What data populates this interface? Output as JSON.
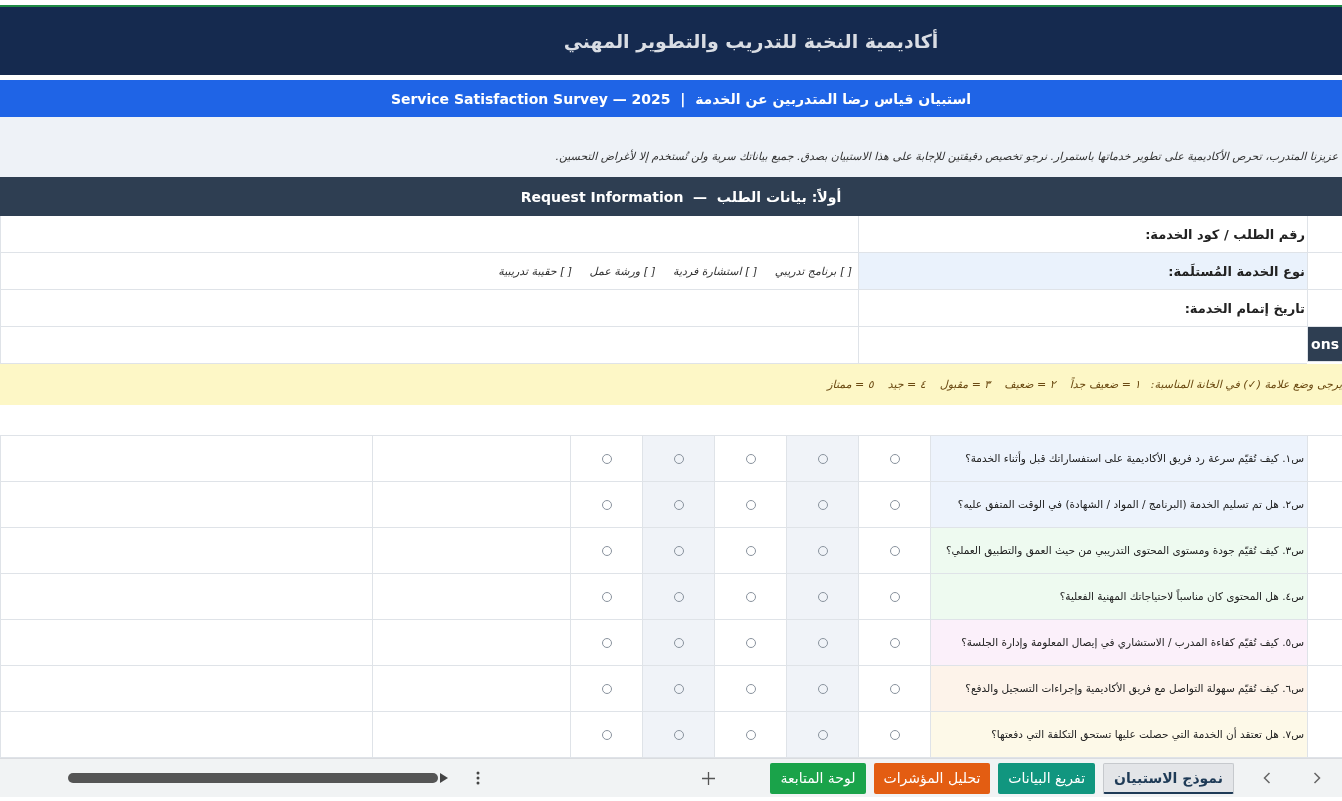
{
  "header": {
    "title": "أكاديمية النخبة للتدريب والتطوير المهني"
  },
  "banner": {
    "title": "استبيان قياس رضا المتدربين عن الخدمة  |  Service Satisfaction Survey — 2025"
  },
  "intro": "عزيزنا المتدرب،  تحرص الأكاديمية على تطوير خدماتها باستمرار. نرجو تخصيص دقيقتين للإجابة على هذا الاستبيان بصدق. جميع بياناتك سرية ولن تُستخدم إلا لأغراض التحسين.",
  "section": {
    "title": "أولاً: بيانات الطلب  —  Request Information"
  },
  "request_fields": [
    {
      "kind": "text",
      "label": "رقم الطلب / كود الخدمة:"
    },
    {
      "kind": "choice",
      "label": "نوع الخدمة المُستلَمة:",
      "value": "[ ] برنامج تدريبي     [ ] استشارة فردية     [ ] ورشة عمل     [ ] حقيبة تدريبية"
    },
    {
      "kind": "text",
      "label": "تاريخ إتمام الخدمة:"
    }
  ],
  "next_section_cell": "ons",
  "rating_hint": "يرجى وضع علامة (✓) في الخانة المناسبة:   ١ = ضعيف جداً    ٢ = ضعيف    ٣ = مقبول    ٤ = جيد    ٥ = ممتاز",
  "questions": [
    {
      "text": "س١. كيف تُقيّم سرعة رد فريق الأكاديمية على استفساراتك قبل وأثناء الخدمة؟",
      "color": "#edf3fc",
      "ratings": [
        {
          "selected": false
        },
        {
          "selected": false
        },
        {
          "selected": false
        },
        {
          "selected": false
        },
        {
          "selected": false
        }
      ]
    },
    {
      "text": "س٢. هل تم تسليم الخدمة (البرنامج / المواد / الشهادة) في الوقت المتفق عليه؟",
      "color": "#edf3fc",
      "ratings": [
        {
          "selected": false
        },
        {
          "selected": false
        },
        {
          "selected": false
        },
        {
          "selected": false
        },
        {
          "selected": false
        }
      ]
    },
    {
      "text": "س٣. كيف تُقيّم جودة ومستوى المحتوى التدريبي من حيث العمق والتطبيق العملي؟",
      "color": "#eefaf0",
      "ratings": [
        {
          "selected": false
        },
        {
          "selected": false
        },
        {
          "selected": false
        },
        {
          "selected": false
        },
        {
          "selected": false
        }
      ]
    },
    {
      "text": "س٤. هل المحتوى كان مناسباً لاحتياجاتك المهنية الفعلية؟",
      "color": "#eefaf0",
      "ratings": [
        {
          "selected": false
        },
        {
          "selected": false
        },
        {
          "selected": false
        },
        {
          "selected": false
        },
        {
          "selected": false
        }
      ]
    },
    {
      "text": "س٥. كيف تُقيّم كفاءة المدرب / الاستشاري في إيصال المعلومة وإدارة الجلسة؟",
      "color": "#fbf0fa",
      "ratings": [
        {
          "selected": false
        },
        {
          "selected": false
        },
        {
          "selected": false
        },
        {
          "selected": false
        },
        {
          "selected": false
        }
      ]
    },
    {
      "text": "س٦. كيف تُقيّم سهولة التواصل مع فريق الأكاديمية وإجراءات التسجيل والدفع؟",
      "color": "#fdf3ea",
      "ratings": [
        {
          "selected": false
        },
        {
          "selected": false
        },
        {
          "selected": false
        },
        {
          "selected": false
        },
        {
          "selected": false
        }
      ]
    },
    {
      "text": "س٧. هل تعتقد أن الخدمة التي حصلت عليها تستحق التكلفة التي دفعتها؟",
      "color": "#fdf9e8",
      "ratings": [
        {
          "selected": false
        },
        {
          "selected": false
        },
        {
          "selected": false
        },
        {
          "selected": false
        },
        {
          "selected": false
        }
      ]
    }
  ],
  "sheet_tabs": [
    {
      "label": "نموذج الاستبيان",
      "selected": true,
      "color": "#1f3b57"
    },
    {
      "label": "تفريغ البيانات",
      "selected": false,
      "color": "#11967f"
    },
    {
      "label": "تحليل المؤشرات",
      "selected": false,
      "color": "#e35d12"
    },
    {
      "label": "لوحة المتابعة",
      "selected": false,
      "color": "#1aa34a"
    }
  ]
}
